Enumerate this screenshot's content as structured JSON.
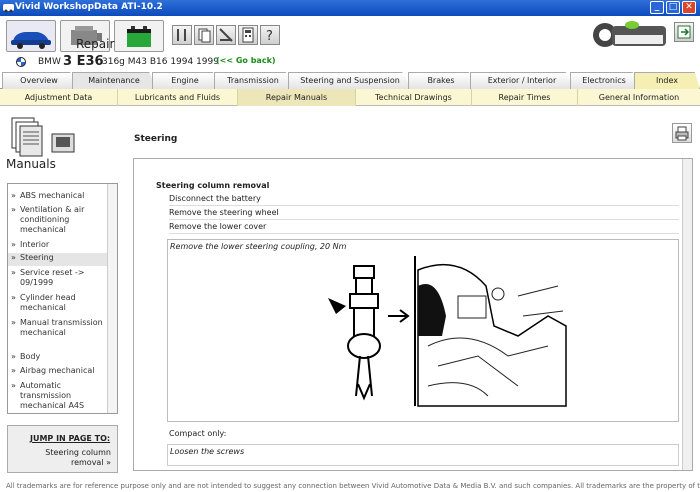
{
  "window": {
    "title": "Vivid WorkshopData ATI-10.2",
    "min": "_",
    "max": "□",
    "close": "✕"
  },
  "vehicle": {
    "make": "BMW",
    "model": "3 E36",
    "details": "316g M43 B16 1994 1999",
    "back": "(<< Go back)"
  },
  "tabs_main": [
    "Overview",
    "Maintenance",
    "Engine",
    "Transmission",
    "Steering and Suspension",
    "Brakes",
    "Exterior / Interior",
    "Electronics",
    "Index"
  ],
  "tabs_sub": [
    "Adjustment Data",
    "Lubricants and Fluids",
    "Repair Manuals",
    "Technical Drawings",
    "Repair Times",
    "General Information"
  ],
  "left": {
    "title_repair": "Repair",
    "title_manuals": "Manuals",
    "items": [
      {
        "arrow": "»",
        "label": "ABS mechanical"
      },
      {
        "arrow": "»",
        "label": "Ventilation & air conditioning mechanical"
      },
      {
        "arrow": "»",
        "label": "Interior"
      },
      {
        "arrow": "»",
        "label": "Steering"
      },
      {
        "arrow": "»",
        "label": "Service reset -> 09/1999"
      },
      {
        "arrow": "»",
        "label": "Cylinder head mechanical"
      },
      {
        "arrow": "»",
        "label": "Manual transmission mechanical"
      },
      {
        "arrow": "»",
        "label": "Body"
      },
      {
        "arrow": "»",
        "label": "Airbag mechanical"
      },
      {
        "arrow": "»",
        "label": "Automatic transmission mechanical A4S"
      }
    ],
    "jump_header": "JUMP IN PAGE TO:",
    "jump_link": "Steering column removal »"
  },
  "content": {
    "page_title": "Steering",
    "section": "Steering column removal",
    "steps": [
      "Disconnect the battery",
      "Remove the steering wheel",
      "Remove the lower cover"
    ],
    "figure_caption": "Remove the lower steering coupling, 20 Nm",
    "compact": "Compact only:",
    "loosen": "Loosen the screws"
  },
  "footer": "All trademarks are for reference purpose only and are not intended to suggest any connection between Vivid Automotive Data & Media B.V. and such companies. All trademarks are the property of their"
}
